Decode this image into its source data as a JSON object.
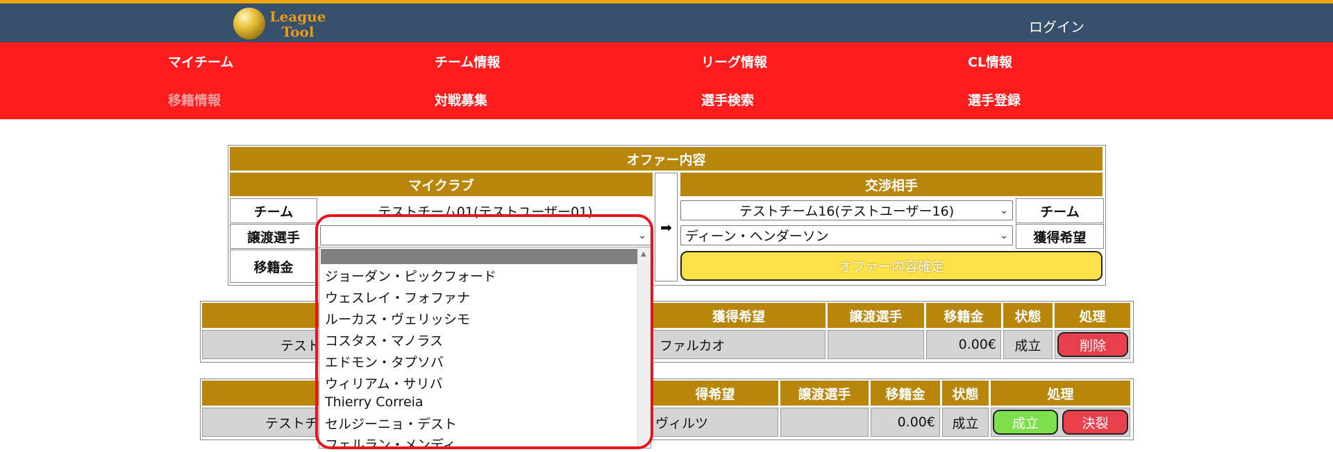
{
  "header": {
    "logo_text": "League Tool",
    "login": "ログイン"
  },
  "nav": {
    "row1": [
      "マイチーム",
      "チーム情報",
      "リーグ情報",
      "CL情報"
    ],
    "row2": [
      "移籍情報",
      "対戦募集",
      "選手検索",
      "選手登録"
    ]
  },
  "offer": {
    "title": "オファー内容",
    "my_club": "マイクラブ",
    "opponent": "交渉相手",
    "team_label": "チーム",
    "transfer_player_label": "譲渡選手",
    "fee_label": "移籍金",
    "acquire_label": "獲得希望",
    "my_team_value": "テストチーム01(テストユーザー01)",
    "transfer_player_value": "",
    "opp_team_value": "テストチーム16(テストユーザー16)",
    "acquire_value": "ディーン・ヘンダーソン",
    "confirm_button": "オファー内容確定",
    "arrow": "➡"
  },
  "dropdown": {
    "options": [
      "",
      "ジョーダン・ピックフォード",
      "ウェスレイ・フォファナ",
      "ルーカス・ヴェリッシモ",
      "コスタス・マノラス",
      "エドモン・タプソバ",
      "ウィリアム・サリバ",
      "Thierry Correia",
      "セルジーニョ・デスト",
      "フェルラン・メンディ"
    ]
  },
  "table1": {
    "headers": [
      "獲得希望",
      "譲渡選手",
      "移籍金",
      "状態",
      "処理"
    ],
    "row": {
      "team_fragment": "テスト",
      "acquire": "ファルカオ",
      "transfer": "",
      "fee": "0.00€",
      "status": "成立",
      "action": "削除"
    }
  },
  "table2": {
    "headers": [
      "得希望",
      "譲渡選手",
      "移籍金",
      "状態",
      "処理"
    ],
    "row": {
      "team_fragment": "テストチ",
      "acquire": "ヴィルツ",
      "transfer": "",
      "fee": "0.00€",
      "status": "成立",
      "accept": "成立",
      "reject": "決裂"
    }
  },
  "colors": {
    "header_bg": "#37506b",
    "nav_bg": "#ff1c1c",
    "gold": "#b8860b",
    "confirm_yellow": "#ffe14a",
    "delete_red": "#e8404a",
    "accept_green": "#7ee04a"
  }
}
